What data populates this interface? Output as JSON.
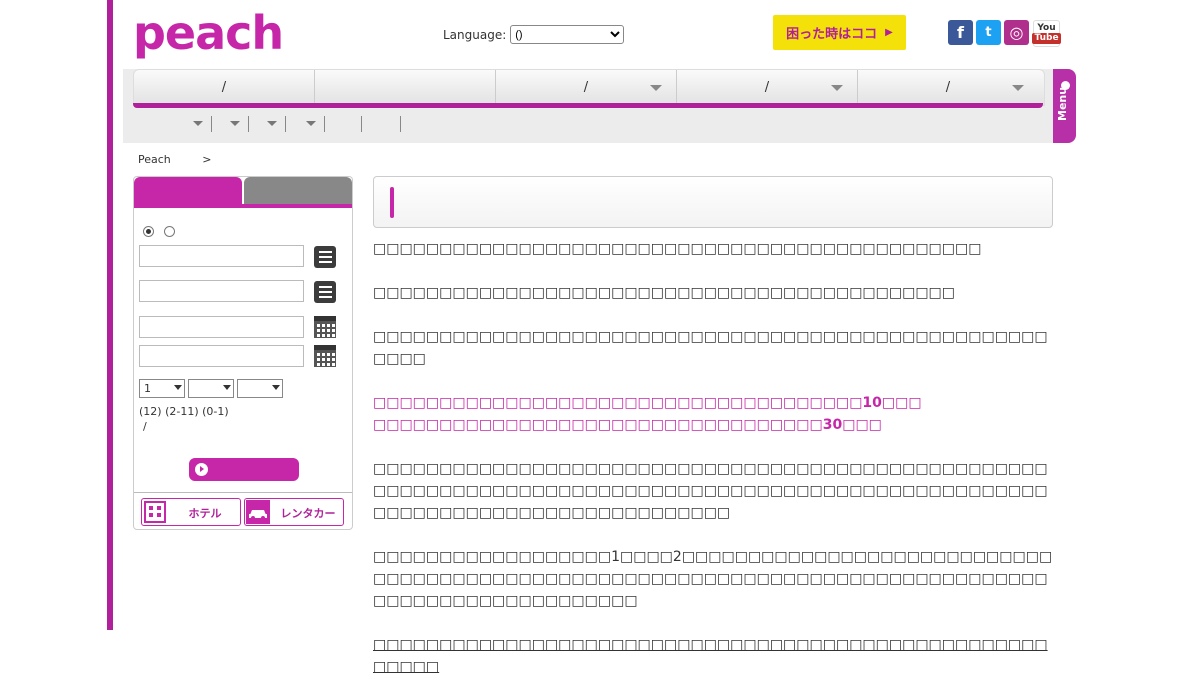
{
  "header": {
    "logo_text": "peach",
    "language_label": "Language:",
    "language_selected": "()",
    "help_button": "困った時はココ",
    "social": {
      "facebook": "f",
      "twitter": "t",
      "instagram": "◎",
      "youtube_top": "You",
      "youtube_bottom": "Tube"
    }
  },
  "nav": {
    "items": [
      {
        "label": "/",
        "has_caret": false
      },
      {
        "label": "",
        "has_caret": false
      },
      {
        "label": "/",
        "has_caret": true
      },
      {
        "label": "/",
        "has_caret": true
      },
      {
        "label": "/",
        "has_caret": true
      }
    ],
    "menu_tab": "Menu"
  },
  "breadcrumb": {
    "home": "Peach",
    "separator": ">"
  },
  "booking": {
    "pax_selects": [
      "1",
      "",
      ""
    ],
    "pax_label": "(12) (2-11) (0-1)",
    "pax_slash": "/",
    "hotel_button": "ホテル",
    "rentacar_button": "レンタカー"
  },
  "content": {
    "para1": "□□□□□□□□□□□□□□□□□□□□□□□□□□□□□□□□□□□□□□□□□□□□□□",
    "para2": "□□□□□□□□□□□□□□□□□□□□□□□□□□□□□□□□□□□□□□□□□□□□",
    "para3": "□□□□□□□□□□□□□□□□□□□□□□□□□□□□□□□□□□□□□□□□□□□□□□□□□□□□□□□",
    "pink1": "□□□□□□□□□□□□□□□□□□□□□□□□□□□□□□□□□□□□□10□□□",
    "pink2": "□□□□□□□□□□□□□□□□□□□□□□□□□□□□□□□□□□30□□□",
    "para4": "□□□□□□□□□□□□□□□□□□□□□□□□□□□□□□□□□□□□□□□□□□□□□□□□□□□□□□□□□□□□□□□□□□□□□□□□□□□□□□□□□□□□□□□□□□□□□□□□□□□□□□□□□□□□□□□□□□□□□□□□□□□□□□□□□",
    "para5": "□□□□□□□□□□□□□□□□□□1□□□□2□□□□□□□□□□□□□□□□□□□□□□□□□□□□□□□□□□□□□□□□□□□□□□□□□□□□□□□□□□□□□□□□□□□□□□□□□□□□□□□□□□□□□□□□□□□□□□□□□□□",
    "para6": "□□□□□□□□□□□□□□□□□□□□□□□□□□□□□□□□□□□□□□□□□□□□□□□□□□□□□□□□"
  }
}
